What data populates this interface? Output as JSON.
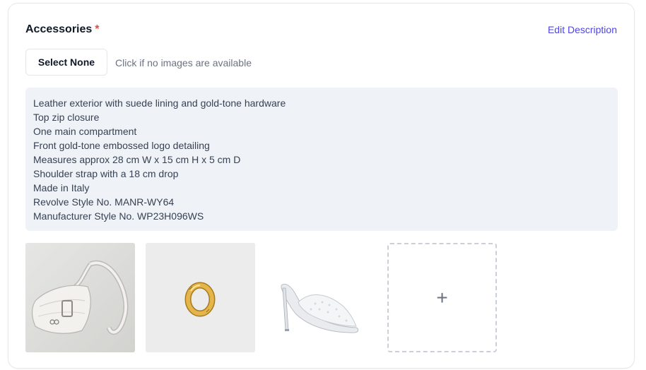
{
  "section": {
    "title": "Accessories",
    "required_mark": "*",
    "edit_link": "Edit Description"
  },
  "controls": {
    "select_none_label": "Select None",
    "hint": "Click if no images are available"
  },
  "description": {
    "lines": [
      "Leather exterior with suede lining and gold-tone hardware",
      "Top zip closure",
      "One main compartment",
      "Front gold-tone embossed logo detailing",
      "Measures approx 28 cm W x 15 cm H x 5 cm D",
      "Shoulder strap with a 18 cm drop",
      "Made in Italy",
      "Revolve Style No. MANR-WY64",
      "Manufacturer Style No. WP23H096WS"
    ]
  },
  "images": [
    {
      "name": "handbag-image",
      "icon": "white-shoulder-bag"
    },
    {
      "name": "earring-image",
      "icon": "gold-hoop-earring"
    },
    {
      "name": "shoe-image",
      "icon": "clear-heeled-mule"
    }
  ],
  "add_tile": {
    "icon": "plus-icon",
    "symbol": "+"
  },
  "colors": {
    "accent": "#4f46e5",
    "required": "#ef4444",
    "description_bg": "#eff3f8"
  }
}
